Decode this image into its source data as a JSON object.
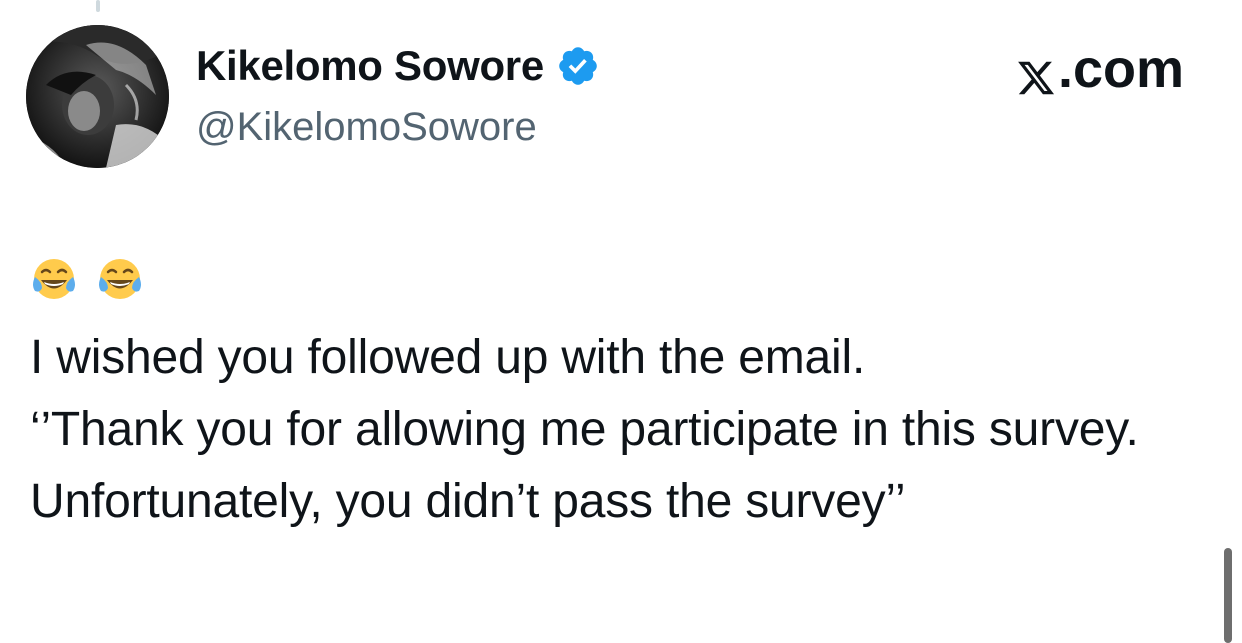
{
  "author": {
    "display_name": "Kikelomo Sowore",
    "handle": "@KikelomoSowore",
    "verified": true,
    "verified_icon": "verified-badge-icon",
    "avatar": "avatar-photo"
  },
  "brand": {
    "label": ".com",
    "icon": "x-logo-icon"
  },
  "tweet": {
    "emojis": [
      "face-with-tears-of-joy",
      "face-with-tears-of-joy"
    ],
    "text": "I wished you followed up with the email.\n‘’Thank you for allowing me participate in this survey. Unfortunately, you didn’t pass the survey’’"
  },
  "colors": {
    "text_primary": "#0f1419",
    "text_secondary": "#536471",
    "verified_blue": "#1d9bf0",
    "background": "#ffffff"
  }
}
